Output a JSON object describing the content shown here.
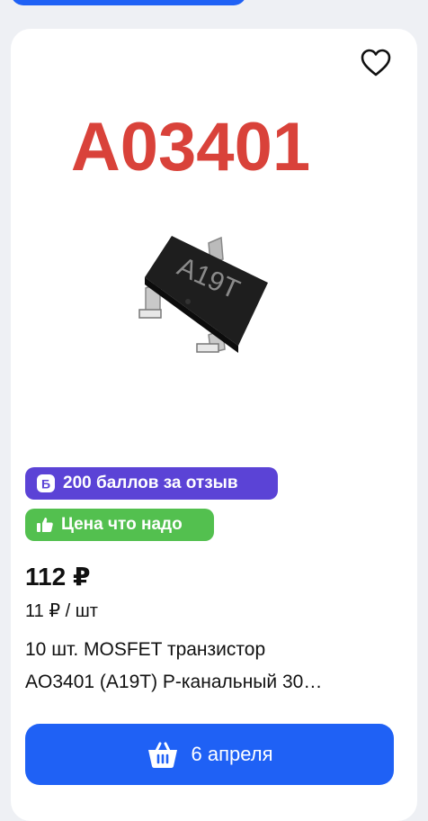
{
  "product": {
    "image": {
      "marking_text": "A03401",
      "chip_text": "A19T"
    },
    "favorite_icon": "heart-icon",
    "badges": [
      {
        "label": "200 баллов за отзыв",
        "icon": "points-icon",
        "color": "#5b43d6"
      },
      {
        "label": "Цена что надо",
        "icon": "thumbs-up-icon",
        "color": "#53c04f"
      }
    ],
    "price": "112 ₽",
    "unit_price": "11 ₽ / шт",
    "title_line1": "10 шт. MOSFET транзистор",
    "title_line2": "AO3401 (A19T) P-канальный 30…",
    "delivery_button": {
      "label": "6 апреля",
      "icon": "basket-icon",
      "color": "#1f61f5"
    }
  }
}
